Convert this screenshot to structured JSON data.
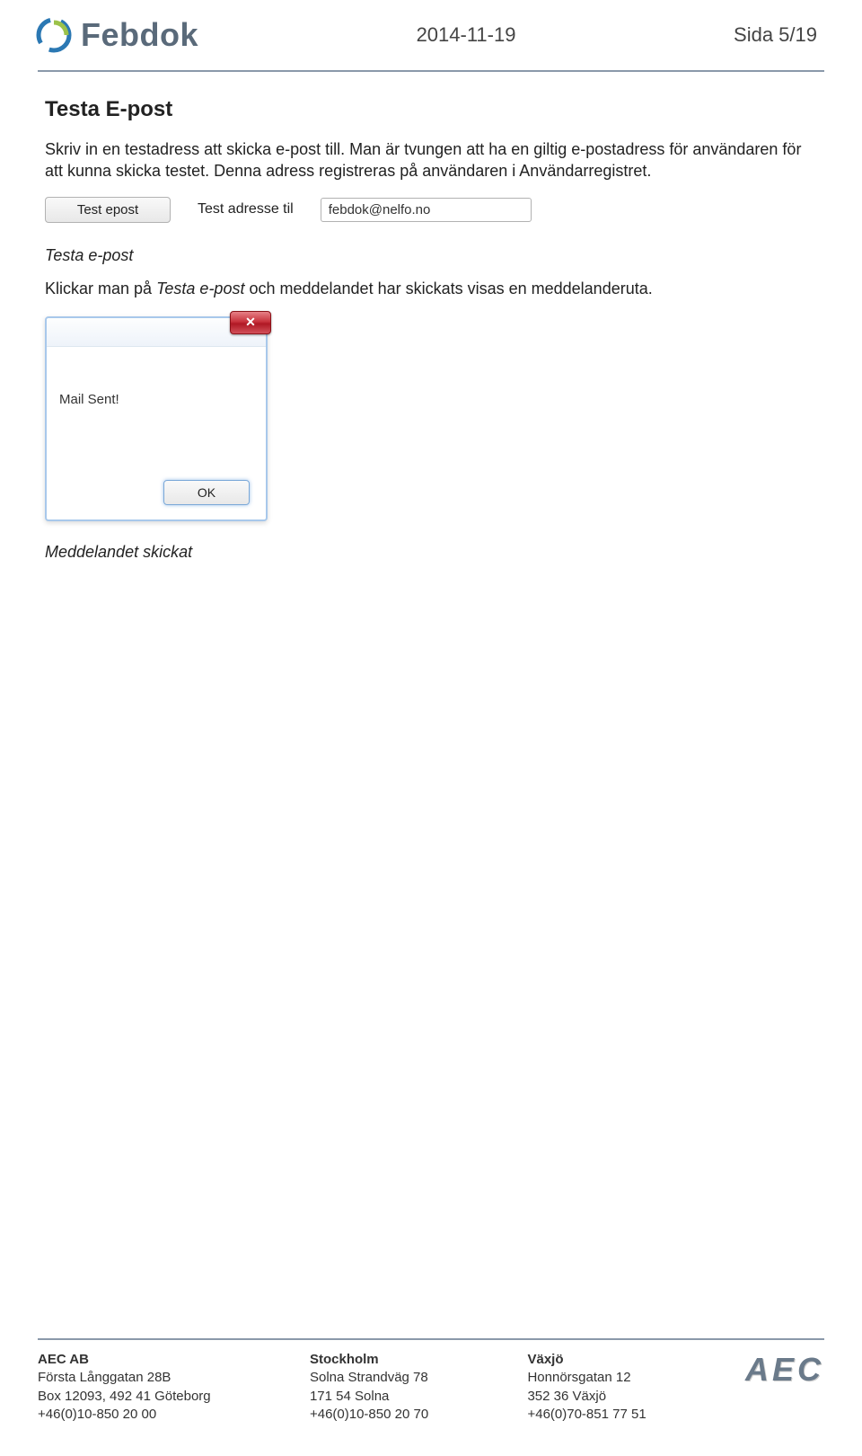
{
  "header": {
    "brand_name": "Febdok",
    "date": "2014-11-19",
    "page_label": "Sida 5/19"
  },
  "section": {
    "title": "Testa E-post",
    "paragraph": "Skriv in en testadress att skicka e-post till. Man är tvungen att ha en giltig e-postadress för användaren för att kunna skicka testet. Denna adress registreras på användaren i Användarregistret."
  },
  "test_row": {
    "button_label": "Test epost",
    "field_label": "Test adresse til",
    "field_value": "febdok@nelfo.no"
  },
  "caption1": "Testa e-post",
  "mixed_line": {
    "pre": "Klickar man på ",
    "em": "Testa e-post",
    "post": " och meddelandet har skickats visas en meddelanderuta."
  },
  "dialog": {
    "message": "Mail Sent!",
    "ok_label": "OK",
    "close_glyph": "✕"
  },
  "caption2": "Meddelandet skickat",
  "footer": {
    "col1": {
      "title": "AEC AB",
      "l1": "Första Långgatan 28B",
      "l2": "Box 12093, 492 41 Göteborg",
      "l3": "+46(0)10-850 20 00"
    },
    "col2": {
      "title": "Stockholm",
      "l1": "Solna Strandväg 78",
      "l2": "171 54 Solna",
      "l3": "+46(0)10-850 20 70"
    },
    "col3": {
      "title": "Växjö",
      "l1": "Honnörsgatan 12",
      "l2": "352 36 Växjö",
      "l3": "+46(0)70-851 77 51"
    },
    "logo_text": "AEC"
  }
}
